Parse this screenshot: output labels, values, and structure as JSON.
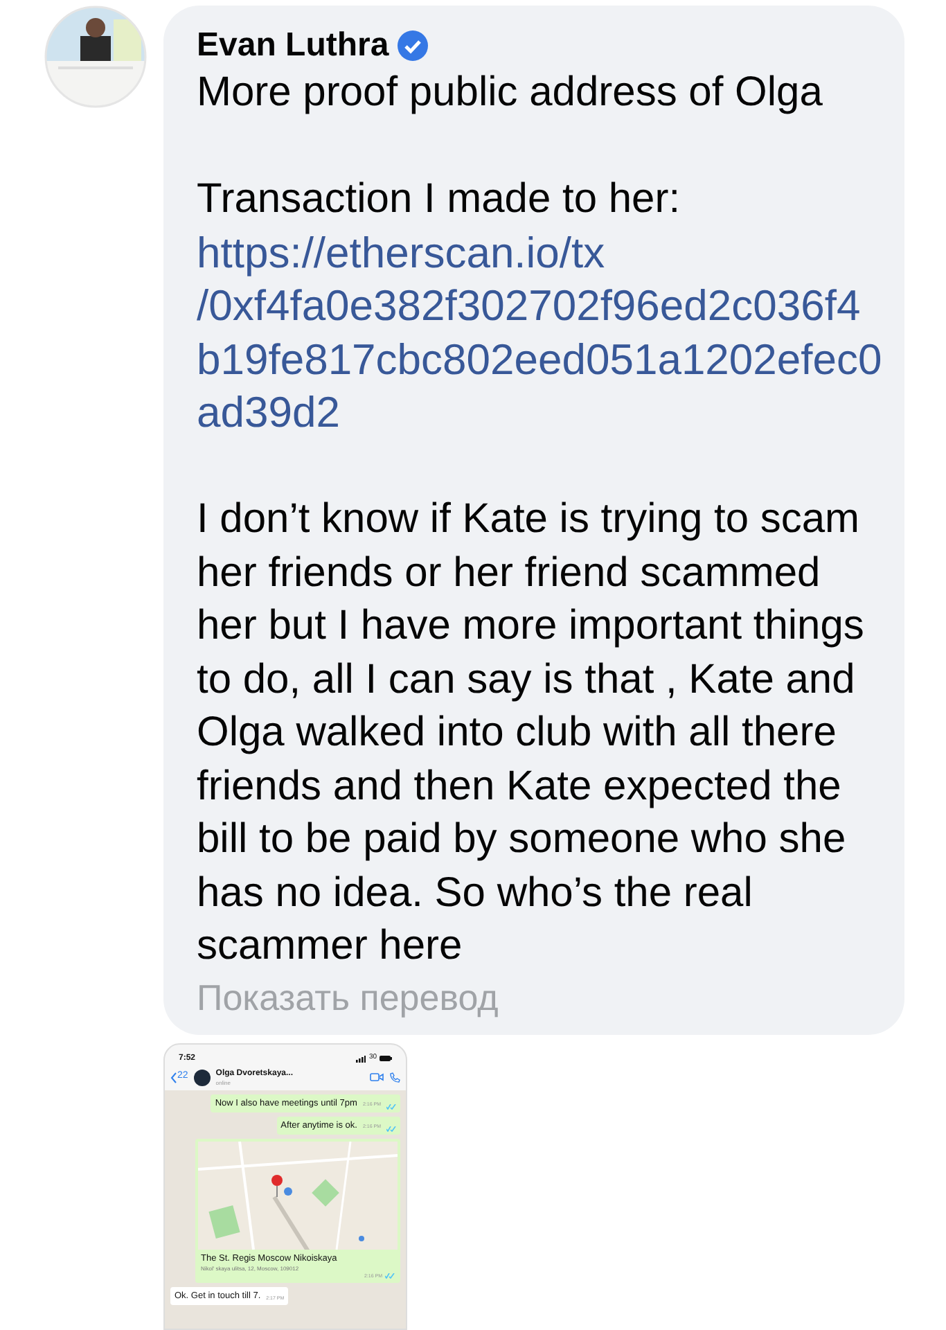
{
  "post": {
    "author": "Evan Luthra",
    "verified": true
  },
  "message": {
    "heading": "More proof public address of Olga",
    "intro": "Transaction I made to her:",
    "link_lines": [
      "https://etherscan.io/tx",
      "/0xf4fa0e382f302702f96ed2c036f4",
      "b19fe817cbc802eed051a1202efec0",
      "ad39d2"
    ],
    "body": "I don’t know if Kate is trying to scam her friends or her friend scammed her but I have more important things to do, all I can say is that , Kate and Olga walked into club with all there friends and then Kate expected the bill to be paid by someone who she has no idea. So who’s the real scammer here",
    "translate": "Показать перевод"
  },
  "attachment": {
    "status_time": "7:52",
    "battery": "30",
    "back_count": "22",
    "contact": "Olga Dvoretskaya...",
    "contact_status": "online",
    "messages": [
      {
        "kind": "text",
        "outgoing": true,
        "text": "Now I also have meetings until 7pm",
        "time": "2:16 PM"
      },
      {
        "kind": "text",
        "outgoing": true,
        "text": "After anytime is ok.",
        "time": "2:16 PM"
      },
      {
        "kind": "location",
        "outgoing": true,
        "title": "The St. Regis Moscow Nikoiskaya",
        "address": "Nikol' skaya ulitsa, 12, Moscow, 109012",
        "time": "2:16 PM"
      },
      {
        "kind": "text",
        "outgoing": false,
        "text": "Ok. Get in touch till 7.",
        "time": "2:17 PM"
      }
    ]
  }
}
